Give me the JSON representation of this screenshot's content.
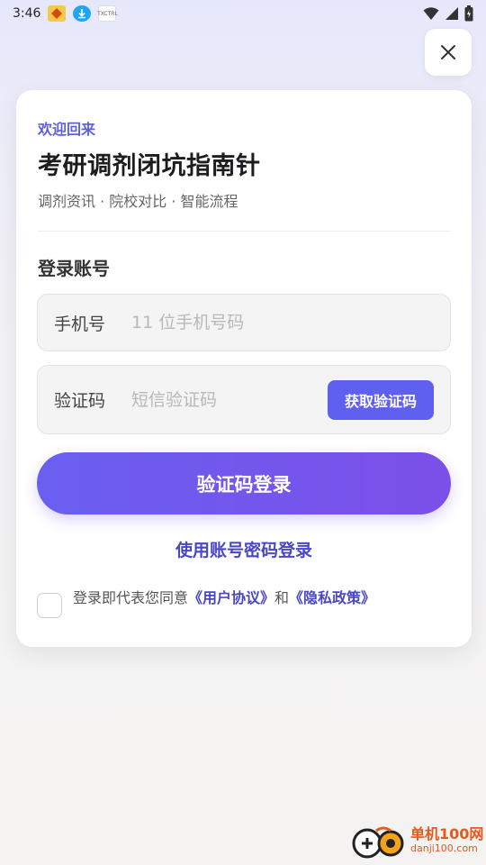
{
  "statusbar": {
    "time": "3:46",
    "app_icon_3_text": "TXCTRL"
  },
  "card": {
    "welcome": "欢迎回来",
    "title": "考研调剂闭坑指南针",
    "subtitle": "调剂资讯 · 院校对比 · 智能流程",
    "section_title": "登录账号"
  },
  "phone_field": {
    "label": "手机号",
    "placeholder": "11 位手机号码",
    "value": ""
  },
  "code_field": {
    "label": "验证码",
    "placeholder": "短信验证码",
    "value": "",
    "button_label": "获取验证码"
  },
  "login_button": "验证码登录",
  "password_login_link": "使用账号密码登录",
  "agreement": {
    "prefix": "登录即代表您同意",
    "terms": "《用户协议》",
    "and": "和",
    "privacy": "《隐私政策》",
    "checked": false
  },
  "watermark": {
    "name": "单机100网",
    "domain": "danji100.com"
  },
  "colors": {
    "accent": "#5f5ff0",
    "link": "#4a46c8",
    "gradient_start": "#6a5ff0",
    "gradient_end": "#7b4fe8"
  },
  "icons": [
    "wifi-icon",
    "signal-icon",
    "battery-icon",
    "download-icon",
    "close-icon"
  ]
}
